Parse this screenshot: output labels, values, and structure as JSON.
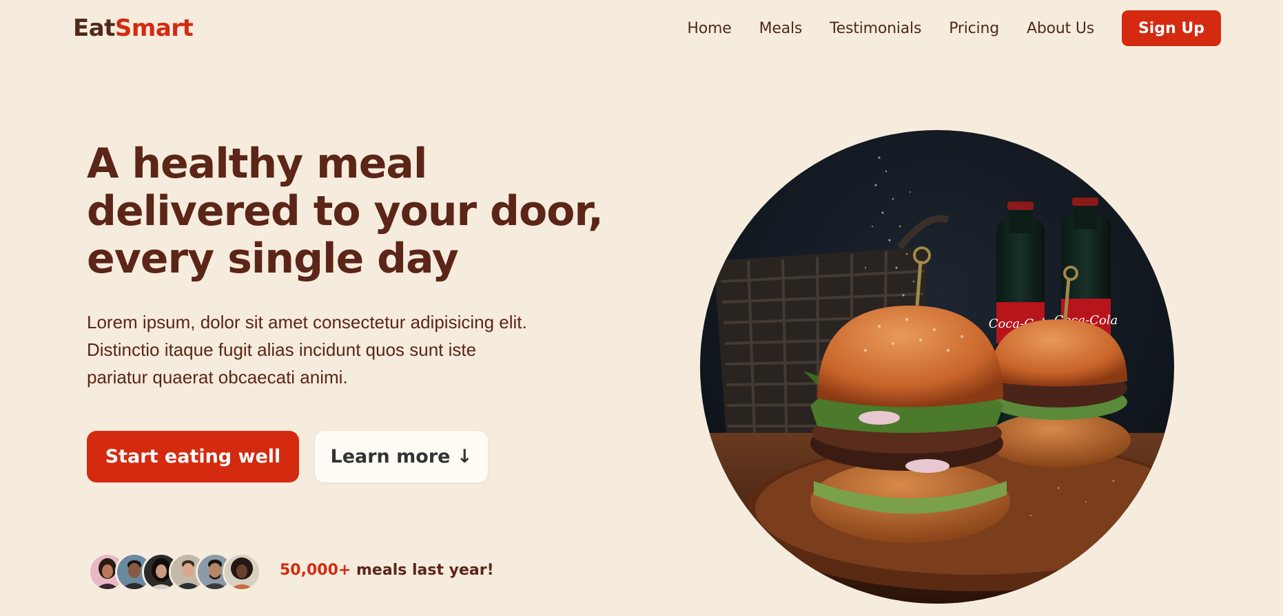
{
  "brand": {
    "part1": "Eat",
    "part2": "Smart"
  },
  "nav": {
    "items": [
      "Home",
      "Meals",
      "Testimonials",
      "Pricing",
      "About Us"
    ],
    "signup_label": "Sign Up"
  },
  "hero": {
    "title_line1": "A healthy meal",
    "title_line2": "delivered to your door,",
    "title_line3": "every single day",
    "description_line1": "Lorem ipsum, dolor sit amet consectetur adipisicing elit.",
    "description_line2": "Distinctio itaque fugit alias incidunt quos sunt iste",
    "description_line3": "pariatur quaerat obcaecati animi.",
    "primary_cta": "Start eating well",
    "secondary_cta": "Learn more ↓",
    "image_alt": "burgers-on-wooden-board"
  },
  "social_proof": {
    "count": "50,000+",
    "text": " meals last year!",
    "avatar_count": 6
  },
  "colors": {
    "background": "#f6ecdd",
    "accent": "#d42a10",
    "heading": "#5b2518",
    "secondary_button": "#fffbf5"
  }
}
